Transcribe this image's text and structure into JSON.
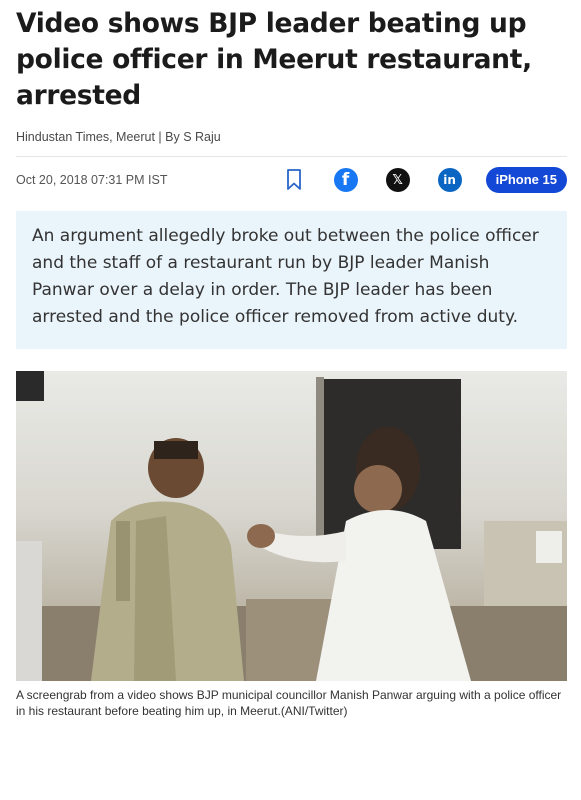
{
  "article": {
    "headline": "Video shows BJP leader beating up police officer in Meerut restaurant, arrested",
    "byline": "Hindustan Times, Meerut | By S Raju",
    "date": "Oct 20, 2018 07:31 PM IST",
    "summary": "An argument allegedly broke out between the police officer and the staff of a restaurant run by BJP leader Manish Panwar over a delay in order. The BJP leader has been arrested and the police officer removed from active duty.",
    "caption": "A screengrab from a video shows BJP municipal councillor Manish Panwar arguing with a police officer in his restaurant before beating him up, in Meerut.(ANI/Twitter)"
  },
  "share": {
    "icons": [
      "bookmark-icon",
      "facebook-icon",
      "x-icon",
      "linkedin-icon"
    ],
    "facebook_glyph": "f",
    "x_glyph": "𝕏",
    "linkedin_glyph": "in",
    "promo_label": "iPhone 15",
    "colors": {
      "facebook": "#1877f2",
      "x": "#111111",
      "linkedin": "#0a66c2",
      "promo": "#1347d6"
    }
  },
  "theme": {
    "summary_bg": "#eaf4fb"
  }
}
